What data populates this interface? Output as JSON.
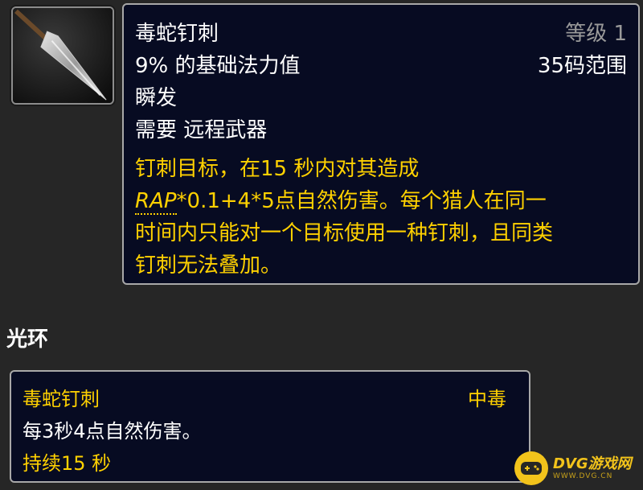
{
  "spell": {
    "name": "毒蛇钉刺",
    "rank": "等级 1",
    "cost": "9% 的基础法力值",
    "range": "35码范围",
    "cast_time": "瞬发",
    "requires": "需要 远程武器",
    "desc_line1": "钉刺目标，在15 秒内对其造成",
    "desc_rap": "RAP",
    "desc_line2_rest": "*0.1+4*5点自然伤害。每个猎人在同一",
    "desc_line3": "时间内只能对一个目标使用一种钉刺，且同类",
    "desc_line4": "钉刺无法叠加。"
  },
  "aura_section": {
    "title": "光环"
  },
  "aura": {
    "name": "毒蛇钉刺",
    "type": "中毒",
    "effect": "每3秒4点自然伤害。",
    "duration": "持续15 秒"
  },
  "watermark": {
    "brand": "DVG游戏网",
    "domain": "WWW.DVG.CN"
  },
  "colors": {
    "tooltip_bg": "#070b22",
    "gold": "#ffd100",
    "border": "#a8a8a8",
    "page_bg": "#262626"
  }
}
